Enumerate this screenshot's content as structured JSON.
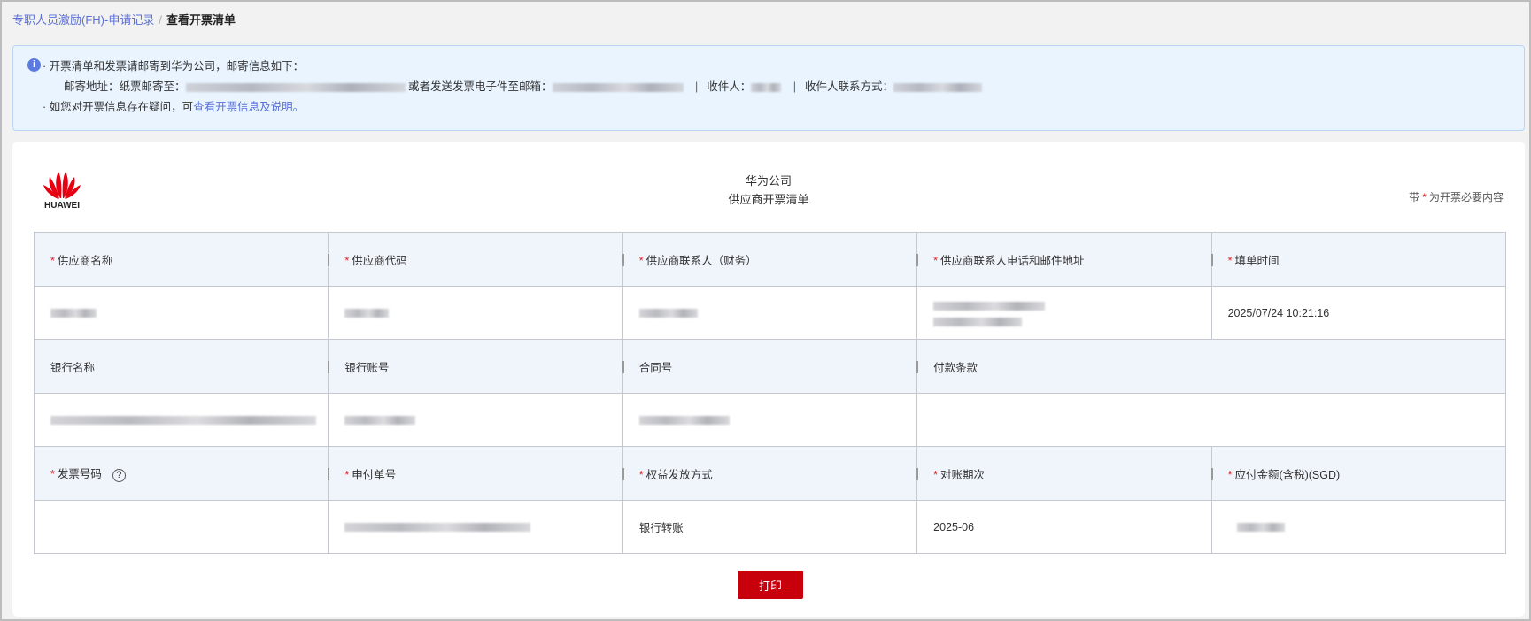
{
  "breadcrumb": {
    "parent": "专职人员激励(FH)-申请记录",
    "sep": "/",
    "current": "查看开票清单"
  },
  "notice": {
    "line1": "· 开票清单和发票请邮寄到华为公司，邮寄信息如下：",
    "address_label": "邮寄地址：纸票邮寄至：",
    "email_label": "或者发送发票电子件至邮箱：",
    "recipient_label": "收件人：",
    "contact_label": "收件人联系方式：",
    "line3_prefix": "· 如您对开票信息存在疑问，可",
    "line3_link": "查看开票信息及说明",
    "line3_suffix": "。"
  },
  "card": {
    "logo_text": "HUAWEI",
    "company": "华为公司",
    "doc_title": "供应商开票清单",
    "req_prefix": "带",
    "req_star": "*",
    "req_suffix": "为开票必要内容"
  },
  "table": {
    "row1_headers": [
      "供应商名称",
      "供应商代码",
      "供应商联系人（财务）",
      "供应商联系人电话和邮件地址",
      "填单时间"
    ],
    "fill_time": "2025/07/24 10:21:16",
    "row2_headers": [
      "银行名称",
      "银行账号",
      "合同号",
      "付款条款"
    ],
    "row3_headers": [
      "发票号码",
      "申付单号",
      "权益发放方式",
      "对账期次",
      "应付金额(含税)(SGD)"
    ],
    "help": "?",
    "payment_method": "银行转账",
    "period": "2025-06"
  },
  "actions": {
    "print": "打印"
  },
  "colors": {
    "brand": "#c7000b",
    "link": "#5a6fd6",
    "header_bg": "#f0f4fb"
  }
}
